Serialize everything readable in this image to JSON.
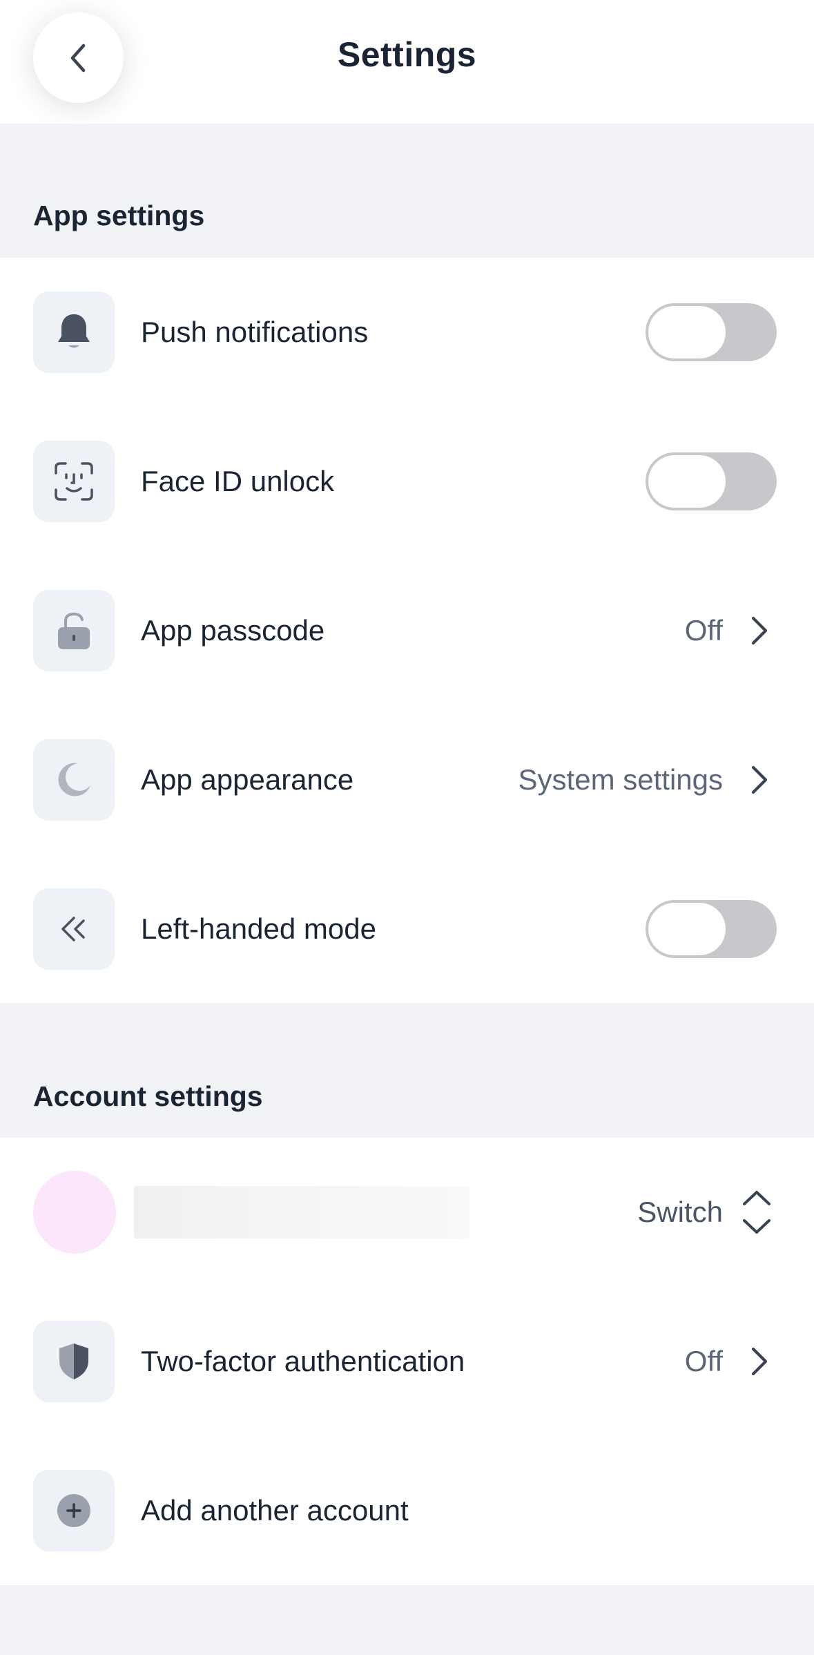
{
  "header": {
    "title": "Settings",
    "back_icon": "chevron-left-icon"
  },
  "app_settings": {
    "title": "App settings",
    "items": [
      {
        "label": "Push notifications",
        "icon": "bell-icon",
        "type": "toggle",
        "on": false
      },
      {
        "label": "Face ID unlock",
        "icon": "face-id-icon",
        "type": "toggle",
        "on": false
      },
      {
        "label": "App passcode",
        "icon": "lock-icon",
        "type": "link",
        "value": "Off"
      },
      {
        "label": "App appearance",
        "icon": "moon-icon",
        "type": "link",
        "value": "System settings"
      },
      {
        "label": "Left-handed mode",
        "icon": "double-chevron-left-icon",
        "type": "toggle",
        "on": false
      }
    ]
  },
  "account_settings": {
    "title": "Account settings",
    "account": {
      "switch_label": "Switch",
      "avatar_color": "#fbe6fb"
    },
    "items": [
      {
        "label": "Two-factor authentication",
        "icon": "shield-icon",
        "type": "link",
        "value": "Off"
      },
      {
        "label": "Add another account",
        "icon": "plus-circle-icon",
        "type": "action"
      }
    ]
  },
  "colors": {
    "background": "#f1f3f7",
    "card": "#ffffff",
    "text": "#1b2433",
    "secondary_text": "#5d6678",
    "icon_box": "#eef1f5",
    "icon": "#6b7382",
    "toggle_off": "#c7c8cb"
  }
}
